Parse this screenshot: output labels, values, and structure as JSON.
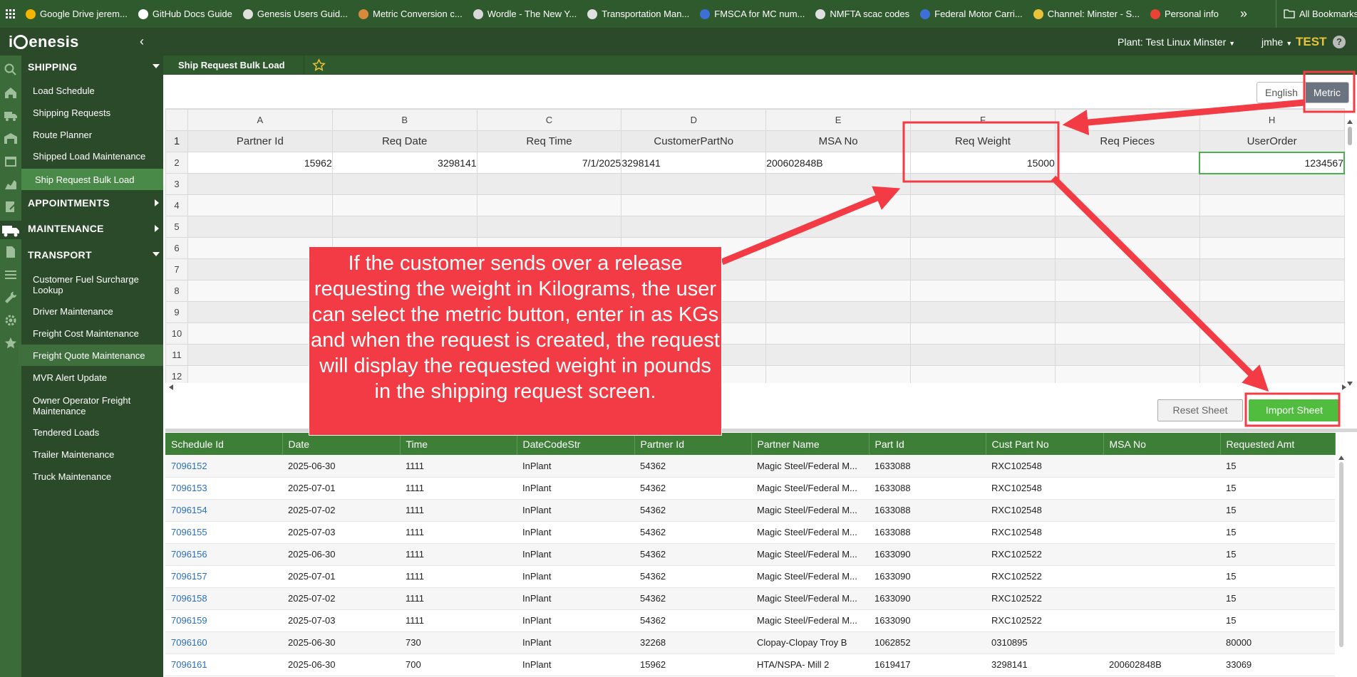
{
  "bookmarks_bar": {
    "items": [
      {
        "label": "Google Drive jerem...",
        "icon": "google-drive-icon",
        "color": "#f4b400"
      },
      {
        "label": "GitHub Docs Guide",
        "icon": "github-icon",
        "color": "#ffffff"
      },
      {
        "label": "Genesis Users Guid...",
        "icon": "globe-icon",
        "color": "#e0e0e0"
      },
      {
        "label": "Metric Conversion c...",
        "icon": "metric-conversion-icon",
        "color": "#d88a3a"
      },
      {
        "label": "Wordle - The New Y...",
        "icon": "wordle-icon",
        "color": "#d8d8d8"
      },
      {
        "label": "Transportation Man...",
        "icon": "globe-icon",
        "color": "#e0e0e0"
      },
      {
        "label": "FMSCA for MC num...",
        "icon": "fmcsa-icon",
        "color": "#3d6fd6"
      },
      {
        "label": "NMFTA scac codes",
        "icon": "globe-icon",
        "color": "#e0e0e0"
      },
      {
        "label": "Federal Motor Carri...",
        "icon": "fmcsa-icon",
        "color": "#3d6fd6"
      },
      {
        "label": "Channel: Minster - S...",
        "icon": "channel-icon",
        "color": "#e8c33a"
      },
      {
        "label": "Personal info",
        "icon": "google-icon",
        "color": "#ea4335"
      }
    ],
    "more": "»",
    "all_bookmarks": "All Bookmarks"
  },
  "header": {
    "plant_label": "Plant: Test Linux Minster",
    "user_label": "jmhe",
    "env_label": "TEST",
    "help_label": "?",
    "logo_pre": "i",
    "logo_post": "enesis",
    "collapse_glyph": "‹"
  },
  "sidebar": {
    "sections": [
      {
        "label": "SHIPPING",
        "expanded": true
      },
      {
        "label": "APPOINTMENTS",
        "expanded": false
      },
      {
        "label": "MAINTENANCE",
        "expanded": false
      },
      {
        "label": "TRANSPORT",
        "expanded": true
      }
    ],
    "shipping_items": [
      "Load Schedule",
      "Shipping Requests",
      "Route Planner",
      "Shipped Load Maintenance",
      "Ship Request Bulk Load"
    ],
    "transport_items": [
      "Customer Fuel Surcharge Lookup",
      "Driver Maintenance",
      "Freight Cost Maintenance",
      "Freight Quote Maintenance",
      "MVR Alert Update",
      "Owner Operator Freight Maintenance",
      "Tendered Loads",
      "Trailer Maintenance",
      "Truck Maintenance"
    ]
  },
  "tabbar": {
    "title": "Ship Request Bulk Load"
  },
  "units": {
    "english": "English",
    "metric": "Metric",
    "selected": "Metric"
  },
  "sheet": {
    "columns": [
      "A",
      "B",
      "C",
      "D",
      "E",
      "F",
      "",
      "H"
    ],
    "row_numbers": [
      "1",
      "2",
      "3",
      "4",
      "5",
      "6",
      "7",
      "8",
      "9",
      "10",
      "11",
      "12"
    ],
    "headers": [
      "Partner Id",
      "Req Date",
      "Req Time",
      "CustomerPartNo",
      "MSA No",
      "Req Weight",
      "Req Pieces",
      "UserOrder"
    ],
    "row2": [
      "15962",
      "3298141",
      "7/1/2025",
      "3298141",
      "200602848B",
      "15000",
      "",
      "1234567"
    ]
  },
  "buttons": {
    "reset": "Reset Sheet",
    "import": "Import Sheet"
  },
  "results": {
    "columns": [
      "Schedule Id",
      "Date",
      "Time",
      "DateCodeStr",
      "Partner Id",
      "Partner Name",
      "Part Id",
      "Cust Part No",
      "MSA No",
      "Requested Amt"
    ],
    "rows": [
      [
        "7096152",
        "2025-06-30",
        "1111",
        "InPlant",
        "54362",
        "Magic Steel/Federal M...",
        "1633088",
        "RXC102548",
        "",
        "15"
      ],
      [
        "7096153",
        "2025-07-01",
        "1111",
        "InPlant",
        "54362",
        "Magic Steel/Federal M...",
        "1633088",
        "RXC102548",
        "",
        "15"
      ],
      [
        "7096154",
        "2025-07-02",
        "1111",
        "InPlant",
        "54362",
        "Magic Steel/Federal M...",
        "1633088",
        "RXC102548",
        "",
        "15"
      ],
      [
        "7096155",
        "2025-07-03",
        "1111",
        "InPlant",
        "54362",
        "Magic Steel/Federal M...",
        "1633088",
        "RXC102548",
        "",
        "15"
      ],
      [
        "7096156",
        "2025-06-30",
        "1111",
        "InPlant",
        "54362",
        "Magic Steel/Federal M...",
        "1633090",
        "RXC102522",
        "",
        "15"
      ],
      [
        "7096157",
        "2025-07-01",
        "1111",
        "InPlant",
        "54362",
        "Magic Steel/Federal M...",
        "1633090",
        "RXC102522",
        "",
        "15"
      ],
      [
        "7096158",
        "2025-07-02",
        "1111",
        "InPlant",
        "54362",
        "Magic Steel/Federal M...",
        "1633090",
        "RXC102522",
        "",
        "15"
      ],
      [
        "7096159",
        "2025-07-03",
        "1111",
        "InPlant",
        "54362",
        "Magic Steel/Federal M...",
        "1633090",
        "RXC102522",
        "",
        "15"
      ],
      [
        "7096160",
        "2025-06-30",
        "730",
        "InPlant",
        "32268",
        "Clopay-Clopay Troy B",
        "1062852",
        "0310895",
        "",
        "80000"
      ],
      [
        "7096161",
        "2025-06-30",
        "700",
        "InPlant",
        "15962",
        "HTA/NSPA- Mill 2",
        "1619417",
        "3298141",
        "200602848B",
        "33069"
      ]
    ]
  },
  "annotation": {
    "text": "If the customer sends over a release requesting the weight in Kilograms, the user can select the metric button, enter in as KGs and when the request is created, the request will display the requested weight in pounds in the shipping request screen.",
    "color": "#f23b44"
  },
  "colors": {
    "header": "#2b4a2a",
    "sidebar": "#2b4a2a",
    "grid_header": "#3e7f37",
    "import": "#50bd3e",
    "env": "#e8c33a",
    "link": "#2a6fbd"
  }
}
